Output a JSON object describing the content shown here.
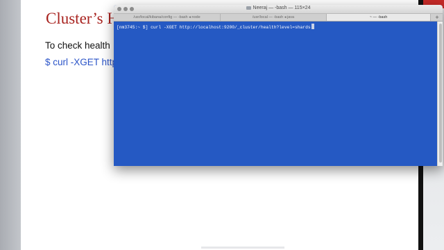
{
  "slide": {
    "title": "Cluster’s H",
    "text": "To check health",
    "command": "$ curl -XGET http"
  },
  "terminal": {
    "window_title": "Neeraj — -bash — 115×24",
    "tabs": [
      {
        "label": "/usr/local/kibana/config — -bash ◂ node"
      },
      {
        "label": "/usr/local — -bash ◂ java"
      },
      {
        "label": "~ — -bash"
      }
    ],
    "new_tab_label": "+",
    "prompt_line": "[nm3745:~ $] curl -XGET http://localhost:9200/_cluster/health?level=shards"
  },
  "colors": {
    "terminal_bg": "#2559c3",
    "title_red": "#a8231f",
    "command_blue": "#2b54c8"
  },
  "icons": [
    "folder-icon",
    "close-icon",
    "minimize-icon",
    "zoom-icon",
    "add-tab-icon"
  ]
}
